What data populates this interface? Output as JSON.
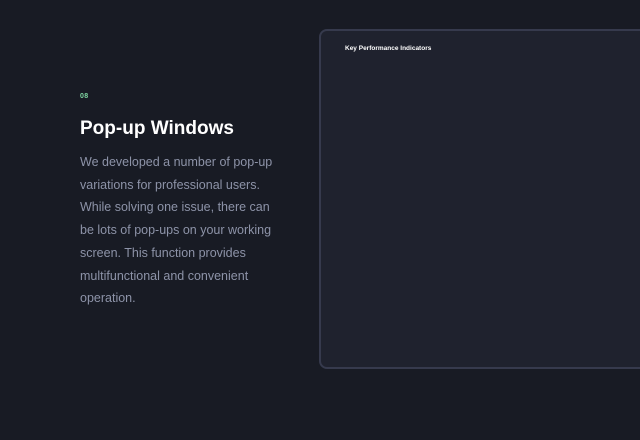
{
  "section": {
    "number": "08",
    "title": "Pop-up Windows",
    "description": "We developed a number of pop-up variations for professional users. While solving one issue, there can be lots of pop-ups on your working screen. This function provides multifunctional and convenient operation."
  },
  "panel": {
    "title": "Key Performance Indicators"
  }
}
